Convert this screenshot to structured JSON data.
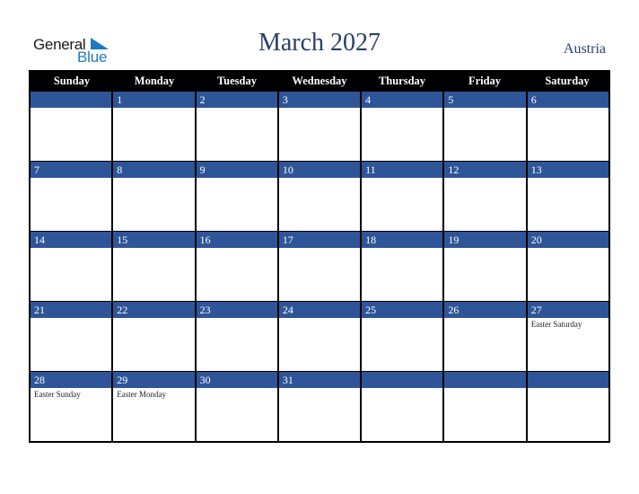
{
  "logo": {
    "line1": "General",
    "line2": "Blue"
  },
  "title": "March 2027",
  "country": "Austria",
  "colors": {
    "header_bg": "#000000",
    "daybar_bg": "#2e5597",
    "title": "#2a3f6a",
    "logo_blue": "#1f7ac3"
  },
  "weekdays": [
    "Sunday",
    "Monday",
    "Tuesday",
    "Wednesday",
    "Thursday",
    "Friday",
    "Saturday"
  ],
  "weeks": [
    [
      {
        "day": "",
        "holiday": ""
      },
      {
        "day": "1",
        "holiday": ""
      },
      {
        "day": "2",
        "holiday": ""
      },
      {
        "day": "3",
        "holiday": ""
      },
      {
        "day": "4",
        "holiday": ""
      },
      {
        "day": "5",
        "holiday": ""
      },
      {
        "day": "6",
        "holiday": ""
      }
    ],
    [
      {
        "day": "7",
        "holiday": ""
      },
      {
        "day": "8",
        "holiday": ""
      },
      {
        "day": "9",
        "holiday": ""
      },
      {
        "day": "10",
        "holiday": ""
      },
      {
        "day": "11",
        "holiday": ""
      },
      {
        "day": "12",
        "holiday": ""
      },
      {
        "day": "13",
        "holiday": ""
      }
    ],
    [
      {
        "day": "14",
        "holiday": ""
      },
      {
        "day": "15",
        "holiday": ""
      },
      {
        "day": "16",
        "holiday": ""
      },
      {
        "day": "17",
        "holiday": ""
      },
      {
        "day": "18",
        "holiday": ""
      },
      {
        "day": "19",
        "holiday": ""
      },
      {
        "day": "20",
        "holiday": ""
      }
    ],
    [
      {
        "day": "21",
        "holiday": ""
      },
      {
        "day": "22",
        "holiday": ""
      },
      {
        "day": "23",
        "holiday": ""
      },
      {
        "day": "24",
        "holiday": ""
      },
      {
        "day": "25",
        "holiday": ""
      },
      {
        "day": "26",
        "holiday": ""
      },
      {
        "day": "27",
        "holiday": "Easter Saturday"
      }
    ],
    [
      {
        "day": "28",
        "holiday": "Easter Sunday"
      },
      {
        "day": "29",
        "holiday": "Easter Monday"
      },
      {
        "day": "30",
        "holiday": ""
      },
      {
        "day": "31",
        "holiday": ""
      },
      {
        "day": "",
        "holiday": ""
      },
      {
        "day": "",
        "holiday": ""
      },
      {
        "day": "",
        "holiday": ""
      }
    ]
  ]
}
